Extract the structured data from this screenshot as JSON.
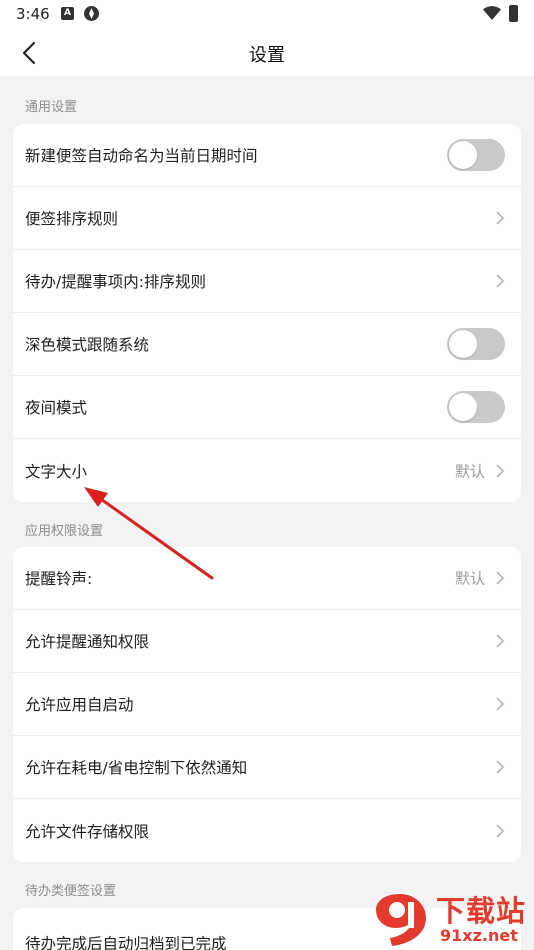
{
  "status_bar": {
    "time": "3:46",
    "icon_a_letter": "A"
  },
  "header": {
    "title": "设置"
  },
  "sections": {
    "general": {
      "label": "通用设置",
      "rows": [
        {
          "label": "新建便签自动命名为当前日期时间",
          "control": "toggle",
          "on": false
        },
        {
          "label": "便签排序规则",
          "control": "chevron"
        },
        {
          "label": "待办/提醒事项内:排序规则",
          "control": "chevron"
        },
        {
          "label": "深色模式跟随系统",
          "control": "toggle",
          "on": false
        },
        {
          "label": "夜间模式",
          "control": "toggle",
          "on": false
        },
        {
          "label": "文字大小",
          "control": "chevron",
          "value": "默认"
        }
      ]
    },
    "permissions": {
      "label": "应用权限设置",
      "rows": [
        {
          "label": "提醒铃声:",
          "control": "chevron",
          "value": "默认"
        },
        {
          "label": "允许提醒通知权限",
          "control": "chevron"
        },
        {
          "label": "允许应用自启动",
          "control": "chevron"
        },
        {
          "label": "允许在耗电/省电控制下依然通知",
          "control": "chevron"
        },
        {
          "label": "允许文件存储权限",
          "control": "chevron"
        }
      ]
    },
    "todo": {
      "label": "待办类便签设置",
      "partial_row_label": "待办完成后自动归档到已完成"
    }
  },
  "watermark": {
    "title": "下载站",
    "url": "91xz.net"
  },
  "colors": {
    "accent_red": "#e23a2c",
    "toggle_off": "#c9c9c9",
    "background": "#f2f3f5"
  }
}
